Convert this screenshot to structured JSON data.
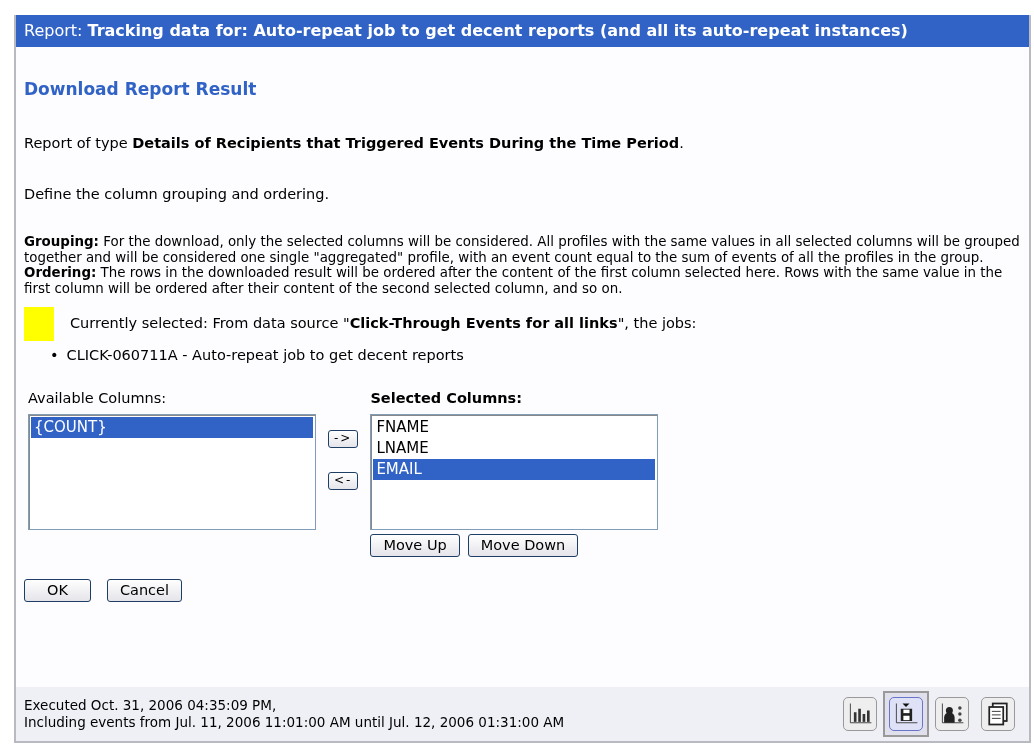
{
  "header": {
    "prefix": "Report:",
    "title": "Tracking data for: Auto-repeat job to get decent reports (and all its auto-repeat instances)"
  },
  "heading": "Download Report Result",
  "report_type": "Report of type **Details of Recipients that Triggered Events During the Time Period**.",
  "instruction": "Define the column grouping and ordering.",
  "help": [
    {
      "term": "Grouping:",
      "text": "For the download, only the selected columns will be considered. All profiles with the same values in all selected columns will be grouped together and will be considered one single \"aggregated\" profile, with an event count equal to the sum of events of all the profiles in the group."
    },
    {
      "term": "Ordering:",
      "text": "The rows in the downloaded result will be ordered after the content of the first column selected here. Rows with the same value in the first column will be ordered after their content of the second selected column, and so on."
    }
  ],
  "selection_note": {
    "color": "#ffff00",
    "text": "Currently selected: From data source \"**Click-Through Events for all links**\", the jobs:"
  },
  "jobs": [
    {
      "bullet": "•",
      "text": "CLICK-060711A - Auto-repeat job to get decent reports"
    }
  ],
  "available": {
    "label": "Available Columns:",
    "items": [
      {
        "text": "{COUNT}",
        "selected": true
      }
    ]
  },
  "move_buttons": [
    "->",
    "<-"
  ],
  "selected": {
    "label": "Selected Columns:",
    "items": [
      {
        "text": "FNAME",
        "selected": false
      },
      {
        "text": "LNAME",
        "selected": false
      },
      {
        "text": "EMAIL",
        "selected": true
      }
    ]
  },
  "order_buttons": [
    "Move Up",
    "Move Down"
  ],
  "dialog_buttons": [
    "OK",
    "Cancel"
  ],
  "footer": {
    "lines": [
      "Executed Oct. 31, 2006 04:35:09 PM,",
      "Including events from Jul. 11, 2006 11:01:00 AM until Jul. 12, 2006 01:31:00 AM"
    ],
    "views": [
      {
        "kind": "chart",
        "selected": false
      },
      {
        "kind": "download",
        "selected": true
      },
      {
        "kind": "recipients",
        "selected": false
      },
      {
        "kind": "pages",
        "selected": false
      }
    ]
  }
}
